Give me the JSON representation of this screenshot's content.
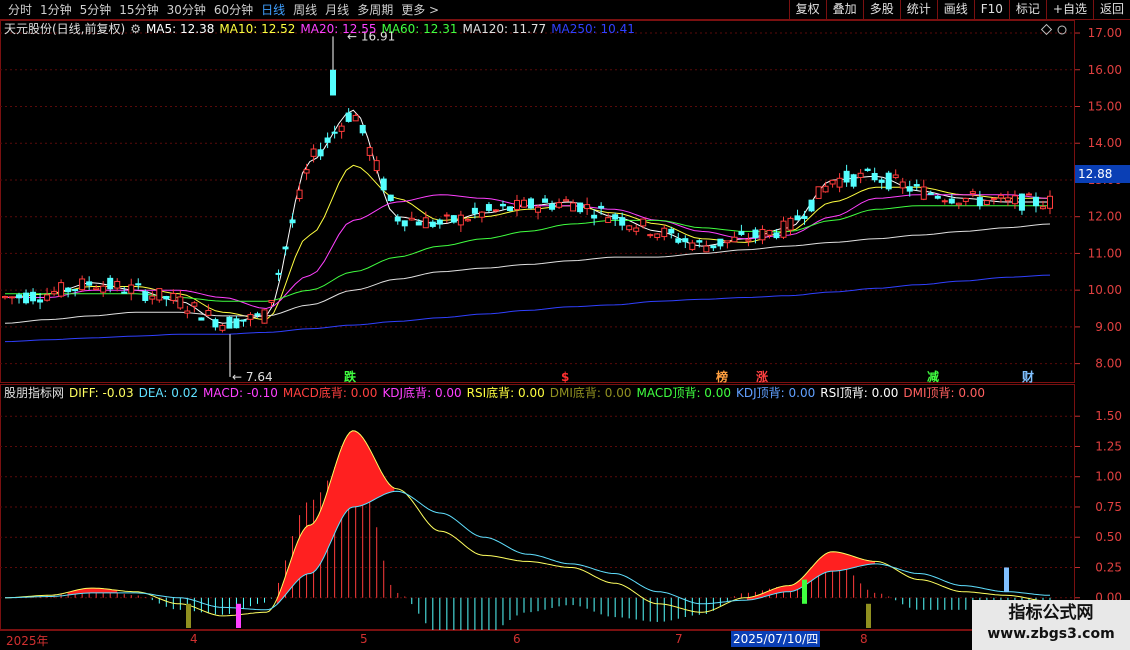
{
  "toolbar": {
    "period_tabs": [
      "分时",
      "1分钟",
      "5分钟",
      "15分钟",
      "30分钟",
      "60分钟",
      "日线",
      "周线",
      "月线",
      "多周期",
      "更多 >"
    ],
    "active_tab": "日线",
    "right_buttons": [
      "复权",
      "叠加",
      "多股",
      "统计",
      "画线",
      "F10",
      "标记",
      "+自选",
      "返回"
    ]
  },
  "main_chart": {
    "title": "天元股份(日线,前复权)",
    "ma": [
      {
        "label": "MA5: 12.38",
        "color": "#ffffff"
      },
      {
        "label": "MA10: 12.52",
        "color": "#ffff40"
      },
      {
        "label": "MA20: 12.55",
        "color": "#ff40ff"
      },
      {
        "label": "MA60: 12.31",
        "color": "#40ff40"
      },
      {
        "label": "MA120: 11.77",
        "color": "#e0e0e0"
      },
      {
        "label": "MA250: 10.41",
        "color": "#3040ff"
      }
    ],
    "current_price": "12.88",
    "high_label": "16.91",
    "low_label": "7.64",
    "events": [
      {
        "text": "跌",
        "color": "#40ff40"
      },
      {
        "text": "$",
        "color": "#ff3030"
      },
      {
        "text": "榜",
        "color": "#ffa040"
      },
      {
        "text": "涨",
        "color": "#ff4040"
      },
      {
        "text": "减",
        "color": "#40ff40"
      },
      {
        "text": "财",
        "color": "#80c0ff"
      }
    ]
  },
  "sub_chart": {
    "title": "股朋指标网",
    "items": [
      {
        "label": "DIFF: -0.03",
        "color": "#ffff60"
      },
      {
        "label": "DEA: 0.02",
        "color": "#60e0ff"
      },
      {
        "label": "MACD: -0.10",
        "color": "#ff40ff"
      },
      {
        "label": "MACD底背: 0.00",
        "color": "#ff4040"
      },
      {
        "label": "KDJ底背: 0.00",
        "color": "#ff40ff"
      },
      {
        "label": "RSI底背: 0.00",
        "color": "#ffff40"
      },
      {
        "label": "DMI底背: 0.00",
        "color": "#909020"
      },
      {
        "label": "MACD顶背: 0.00",
        "color": "#40ff40"
      },
      {
        "label": "KDJ顶背: 0.00",
        "color": "#60a0ff"
      },
      {
        "label": "RSI顶背: 0.00",
        "color": "#ffffff"
      },
      {
        "label": "DMI顶背: 0.00",
        "color": "#ff6060"
      }
    ]
  },
  "x_axis": {
    "labels": [
      "2025年",
      "4",
      "5",
      "6",
      "7",
      "8"
    ],
    "highlight": "2025/07/10/四"
  },
  "chart_data": [
    {
      "type": "candlestick",
      "title": "天元股份(日线,前复权)",
      "yticks": [
        8.0,
        9.0,
        10.0,
        11.0,
        12.0,
        13.0,
        14.0,
        15.0,
        16.0,
        17.0
      ],
      "ylim": [
        7.5,
        17.3
      ],
      "x": [
        "2025年",
        "4",
        "5",
        "6",
        "7",
        "8"
      ],
      "series": [
        {
          "name": "MA5",
          "values": [
            9.8,
            9.9,
            10.2,
            10.0,
            9.7,
            9.1,
            9.3,
            13.5,
            14.9,
            12.0,
            11.8,
            12.1,
            12.3,
            12.4,
            12.0,
            11.6,
            11.2,
            11.4,
            11.7,
            13.0,
            13.1,
            12.7,
            12.5,
            12.4,
            12.4
          ]
        },
        {
          "name": "MA10",
          "values": [
            9.8,
            9.9,
            10.1,
            10.1,
            9.9,
            9.4,
            9.2,
            11.5,
            13.4,
            12.5,
            11.9,
            12.0,
            12.2,
            12.3,
            12.1,
            11.8,
            11.4,
            11.3,
            11.6,
            12.4,
            12.8,
            12.8,
            12.6,
            12.5,
            12.5
          ]
        },
        {
          "name": "MA20",
          "values": [
            9.8,
            9.8,
            10.0,
            10.0,
            10.0,
            9.8,
            9.5,
            10.4,
            11.9,
            12.4,
            12.6,
            12.5,
            12.3,
            12.3,
            12.2,
            11.9,
            11.6,
            11.4,
            11.5,
            12.0,
            12.5,
            12.6,
            12.6,
            12.6,
            12.5
          ]
        },
        {
          "name": "MA60",
          "values": [
            9.9,
            9.9,
            9.9,
            9.9,
            9.8,
            9.7,
            9.7,
            10.0,
            10.5,
            10.9,
            11.2,
            11.4,
            11.6,
            11.8,
            11.9,
            11.9,
            11.7,
            11.6,
            11.6,
            11.9,
            12.2,
            12.3,
            12.3,
            12.3,
            12.3
          ]
        },
        {
          "name": "MA120",
          "values": [
            9.1,
            9.2,
            9.3,
            9.4,
            9.4,
            9.3,
            9.3,
            9.6,
            10.0,
            10.3,
            10.5,
            10.6,
            10.7,
            10.8,
            10.9,
            10.9,
            11.0,
            11.1,
            11.2,
            11.3,
            11.4,
            11.5,
            11.6,
            11.7,
            11.8
          ]
        },
        {
          "name": "MA250",
          "values": [
            8.6,
            8.65,
            8.7,
            8.75,
            8.8,
            8.8,
            8.85,
            8.95,
            9.05,
            9.15,
            9.25,
            9.35,
            9.45,
            9.55,
            9.6,
            9.7,
            9.75,
            9.8,
            9.85,
            9.95,
            10.05,
            10.15,
            10.25,
            10.35,
            10.41
          ]
        }
      ],
      "annotations": [
        "16.91",
        "7.64"
      ]
    },
    {
      "type": "bar",
      "title": "股朋指标网",
      "yticks": [
        0.0,
        0.25,
        0.5,
        0.75,
        1.0,
        1.25,
        1.5
      ],
      "ylim": [
        -0.25,
        1.7
      ],
      "series": [
        {
          "name": "DIFF",
          "values": [
            0.0,
            0.02,
            0.08,
            0.05,
            -0.05,
            -0.15,
            -0.12,
            0.6,
            1.38,
            0.9,
            0.55,
            0.35,
            0.3,
            0.25,
            0.12,
            -0.05,
            -0.12,
            0.0,
            0.1,
            0.38,
            0.3,
            0.15,
            0.05,
            0.02,
            -0.03
          ]
        },
        {
          "name": "DEA",
          "values": [
            0.0,
            0.01,
            0.04,
            0.04,
            0.0,
            -0.08,
            -0.1,
            0.2,
            0.75,
            0.88,
            0.7,
            0.5,
            0.36,
            0.28,
            0.2,
            0.05,
            -0.05,
            -0.02,
            0.05,
            0.22,
            0.28,
            0.2,
            0.1,
            0.05,
            0.02
          ]
        },
        {
          "name": "MACD",
          "values": [
            0.0,
            0.02,
            0.08,
            0.02,
            -0.1,
            -0.14,
            -0.04,
            0.8,
            1.26,
            0.04,
            -0.3,
            -0.3,
            -0.12,
            -0.06,
            -0.16,
            -0.2,
            -0.14,
            0.04,
            0.1,
            0.32,
            0.04,
            -0.1,
            -0.1,
            -0.06,
            -0.1
          ]
        }
      ]
    }
  ]
}
